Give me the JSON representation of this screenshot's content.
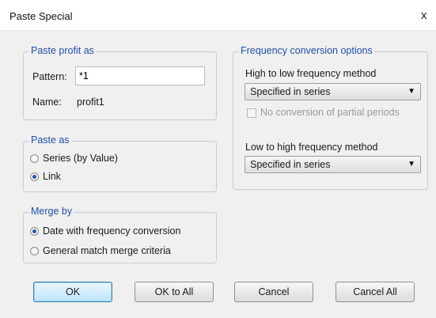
{
  "dialog": {
    "title": "Paste Special",
    "close_symbol": "x"
  },
  "paste_profit": {
    "legend": "Paste profit as",
    "pattern_label": "Pattern:",
    "pattern_value": "*1",
    "name_label": "Name:",
    "name_value": "profit1"
  },
  "paste_as": {
    "legend": "Paste as",
    "options": [
      {
        "label": "Series (by Value)",
        "selected": false
      },
      {
        "label": "Link",
        "selected": true
      }
    ]
  },
  "merge_by": {
    "legend": "Merge by",
    "options": [
      {
        "label": "Date with frequency conversion",
        "selected": true
      },
      {
        "label": "General match merge criteria",
        "selected": false
      }
    ]
  },
  "frequency": {
    "legend": "Frequency conversion options",
    "high_to_low_label": "High to low frequency method",
    "high_to_low_value": "Specified in series",
    "no_partial_label": "No conversion of partial periods",
    "no_partial_checked": false,
    "no_partial_enabled": false,
    "low_to_high_label": "Low to high frequency method",
    "low_to_high_value": "Specified in series"
  },
  "buttons": {
    "ok": "OK",
    "ok_all": "OK to All",
    "cancel": "Cancel",
    "cancel_all": "Cancel All"
  }
}
